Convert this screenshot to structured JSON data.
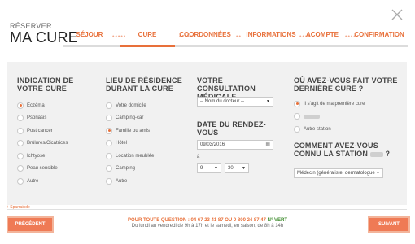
{
  "header": {
    "reserve_label": "RÉSERVER",
    "title": "MA CURE"
  },
  "steps": [
    {
      "label": "SÉJOUR",
      "active": false
    },
    {
      "label": "CURE",
      "active": true
    },
    {
      "label": "COORDONNÉES",
      "active": false
    },
    {
      "label": "INFORMATIONS",
      "active": false
    },
    {
      "label": "ACOMPTE",
      "active": false
    },
    {
      "label": "CONFIRMATION",
      "active": false
    }
  ],
  "indication": {
    "title": "INDICATION DE VOTRE CURE",
    "options": [
      "Eczéma",
      "Psoriasis",
      "Post cancer",
      "Brûlures/Cicatrices",
      "Ichtyose",
      "Peau sensible",
      "Autre"
    ],
    "selected": "Eczéma"
  },
  "residence": {
    "title": "LIEU DE RÉSIDENCE DURANT LA CURE",
    "options": [
      "Votre domicile",
      "Camping-car",
      "Famille ou amis",
      "Hôtel",
      "Location meublée",
      "Camping",
      "Autre"
    ],
    "selected": "Famille ou amis"
  },
  "consultation": {
    "title": "VOTRE CONSULTATION MÉDICALE",
    "doctor_select": "-- Nom du docteur --",
    "date_title": "DATE DU RENDEZ-VOUS",
    "date_value": "09/03/2016",
    "hour_prefix": "à",
    "hour_value": "9",
    "minute_value": "30"
  },
  "last_cure": {
    "title": "OÙ AVEZ-VOUS FAIT VOTRE DERNIÈRE CURE ?",
    "options": [
      "Il s'agit de ma première cure",
      "",
      "Autre station"
    ],
    "selected": "Il s'agit de ma première cure"
  },
  "knowledge": {
    "title": "COMMENT AVEZ-VOUS CONNU LA STATION",
    "title_suffix": "?",
    "select_value": "Médecin (généraliste, dermatologue"
  },
  "sponsor_text": "+ Sparrainde",
  "footer": {
    "prev_label": "PRÉCÉDENT",
    "next_label": "SUIVANT",
    "phone_prefix": "POUR TOUTE QUESTION : 04 67 23 41 87 OU 0 800 24 87 47",
    "phone_suffix": "N° VERT",
    "hours": "Du lundi au vendredi de 9h à 17h et le samedi, en saison, de 8h à 14h"
  },
  "colors": {
    "accent": "#e8703a",
    "button": "#ef7a55",
    "green": "#3b8a2a",
    "panel": "#f1f1f1"
  }
}
